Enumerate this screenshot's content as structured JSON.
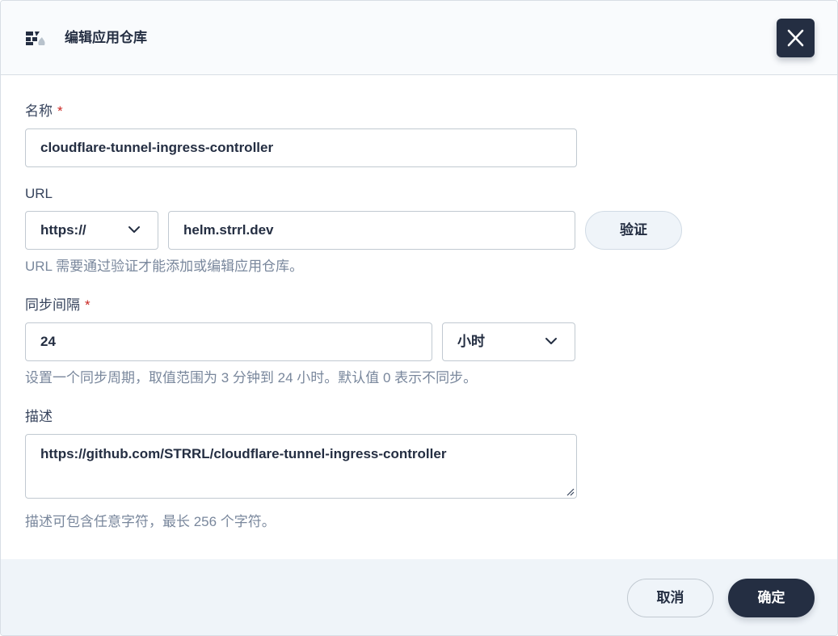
{
  "dialog": {
    "title": "编辑应用仓库",
    "icon": "app-store-icon",
    "close_icon": "close-icon"
  },
  "form": {
    "name": {
      "label": "名称",
      "required_mark": "*",
      "value": "cloudflare-tunnel-ingress-controller"
    },
    "url": {
      "label": "URL",
      "protocol": "https://",
      "value": "helm.strrl.dev",
      "verify_label": "验证",
      "hint": "URL 需要通过验证才能添加或编辑应用仓库。"
    },
    "sync_interval": {
      "label": "同步间隔",
      "required_mark": "*",
      "value": "24",
      "unit": "小时",
      "hint": "设置一个同步周期，取值范围为 3 分钟到 24 小时。默认值 0 表示不同步。"
    },
    "description": {
      "label": "描述",
      "value": "https://github.com/STRRL/cloudflare-tunnel-ingress-controller",
      "hint": "描述可包含任意字符，最长 256 个字符。"
    }
  },
  "footer": {
    "cancel_label": "取消",
    "confirm_label": "确定"
  },
  "colors": {
    "primary_dark": "#242e42",
    "required": "#ca2621",
    "hint": "#79879c",
    "footer_bg": "#eff4f9"
  }
}
